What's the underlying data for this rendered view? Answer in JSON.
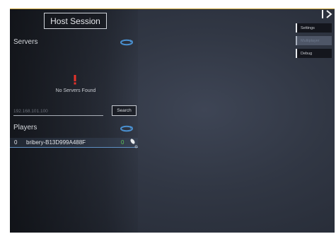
{
  "header": {
    "host_session_label": "Host Session"
  },
  "servers": {
    "title": "Servers",
    "refresh_icon": "refresh-icon",
    "warning_icon": "exclamation-icon",
    "empty_message": "No Servers Found"
  },
  "search": {
    "ip_placeholder": "192.168.101.100",
    "search_label": "Search"
  },
  "players": {
    "title": "Players",
    "refresh_icon": "refresh-icon",
    "rows": [
      {
        "index": "0",
        "name": "bribery-B13D999A488F",
        "count": "0",
        "mic_icon": "microphone-icon"
      }
    ]
  },
  "side_menu": {
    "close_icon": "collapse-chevron-icon",
    "tabs": [
      {
        "label": "Settings",
        "active": false
      },
      {
        "label": "Multiplayer",
        "active": true
      },
      {
        "label": "Debug",
        "active": false
      }
    ]
  },
  "colors": {
    "accent_border": "#c9a43a",
    "refresh_blue": "#4a90d0",
    "warning_red": "#e8332a",
    "player_count_green": "#5cc85a"
  }
}
